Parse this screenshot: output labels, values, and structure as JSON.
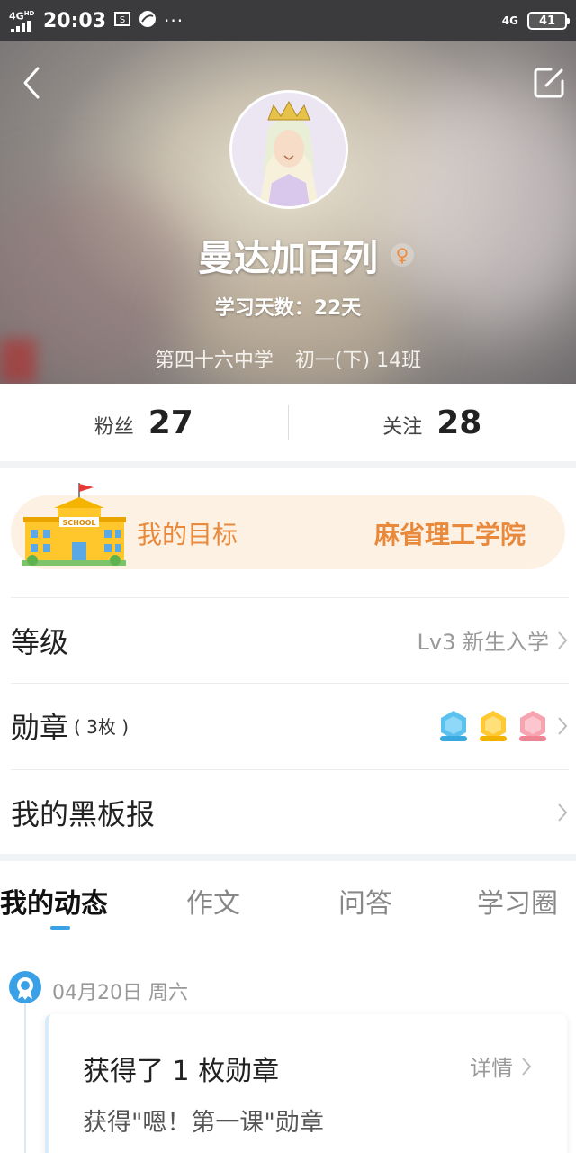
{
  "status_bar": {
    "network": "4G",
    "network_sup": "HD",
    "time": "20:03",
    "more": "···",
    "right_network": "4G",
    "battery": "41"
  },
  "profile": {
    "username": "曼达加百列",
    "gender_symbol": "♀",
    "study_days": "学习天数：22天",
    "school": "第四十六中学",
    "class": "初一(下) 14班"
  },
  "stats": {
    "fans_label": "粉丝",
    "fans_count": "27",
    "follow_label": "关注",
    "follow_count": "28"
  },
  "goal": {
    "label": "我的目标",
    "value": "麻省理工学院",
    "icon_text": "SCHOOL"
  },
  "menu": {
    "level_label": "等级",
    "level_value": "Lv3 新生入学",
    "medal_label": "勋章",
    "medal_count": "( 3枚 )",
    "blackboard_label": "我的黑板报"
  },
  "tabs": [
    "我的动态",
    "作文",
    "问答",
    "学习圈"
  ],
  "feed": {
    "date": "04月20日 周六",
    "card_title": "获得了 1 枚勋章",
    "card_detail": "详情",
    "card_desc": "获得\"嗯！第一课\"勋章"
  },
  "colors": {
    "accent_orange": "#e8893c",
    "accent_blue": "#3aa1e6",
    "goal_bg": "#fdf1e4"
  },
  "icons": [
    "back-icon",
    "edit-icon",
    "gender-female-icon",
    "school-building-icon",
    "chevron-right-icon",
    "medal-icon"
  ]
}
